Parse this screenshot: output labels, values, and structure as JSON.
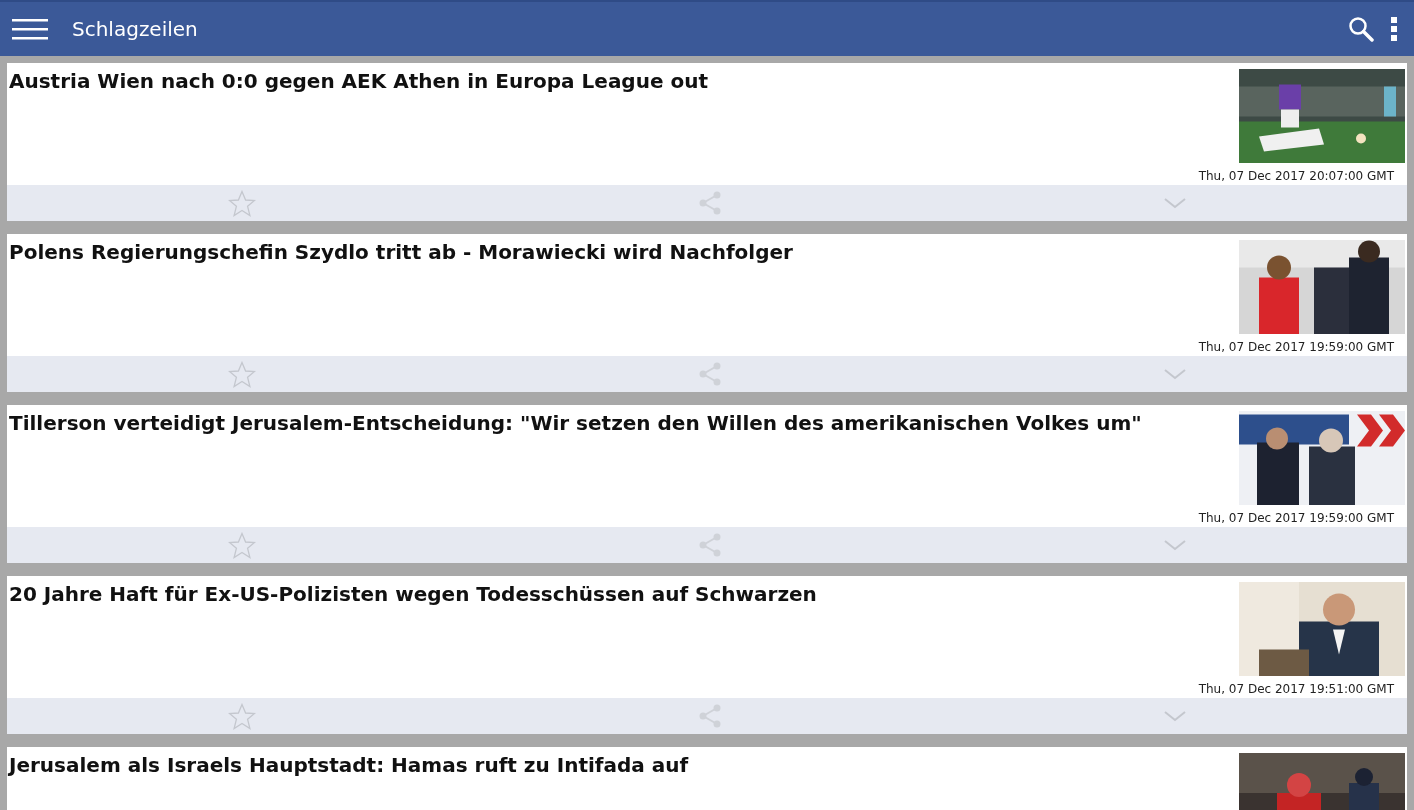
{
  "app_bar": {
    "title": "Schlagzeilen"
  },
  "articles": [
    {
      "title": "Austria Wien nach 0:0 gegen AEK Athen in Europa League out",
      "time": "Thu, 07 Dec 2017 20:07:00 GMT",
      "starred": false
    },
    {
      "title": "Polens Regierungschefin Szydlo tritt ab - Morawiecki wird Nachfolger",
      "time": "Thu, 07 Dec 2017 19:59:00 GMT",
      "starred": false
    },
    {
      "title": "Tillerson verteidigt Jerusalem-Entscheidung: \"Wir setzen den Willen des amerikanischen Volkes um\"",
      "time": "Thu, 07 Dec 2017 19:59:00 GMT",
      "starred": false
    },
    {
      "title": "20 Jahre Haft für Ex-US-Polizisten wegen Todesschüssen auf Schwarzen",
      "time": "Thu, 07 Dec 2017 19:51:00 GMT",
      "starred": false
    },
    {
      "title": "Jerusalem als Israels Hauptstadt: Hamas ruft zu Intifada auf"
    }
  ]
}
